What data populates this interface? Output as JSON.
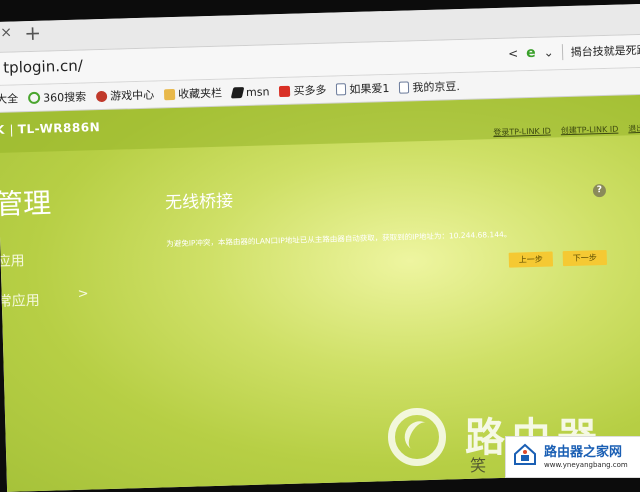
{
  "browser": {
    "tab_close_icon": "×",
    "new_tab_icon": "+",
    "url": "tplogin.cn/",
    "news_ticker": "揭台技就是死路一条",
    "bookmarks": [
      {
        "icon": "360-icon",
        "label": "大全"
      },
      {
        "icon": "360-search-icon",
        "label": "360搜索"
      },
      {
        "icon": "game-center-icon",
        "label": "游戏中心"
      },
      {
        "icon": "folder-icon",
        "label": "收藏夹栏"
      },
      {
        "icon": "msn-icon",
        "label": "msn"
      },
      {
        "icon": "jd-icon",
        "label": "买多多"
      },
      {
        "icon": "doc-icon",
        "label": "如果爱1"
      },
      {
        "icon": "doc-icon",
        "label": "我的京豆."
      }
    ]
  },
  "router": {
    "brand": "K",
    "model": "TL-WR886N",
    "top_links": {
      "login": "登录TP-LINK ID",
      "create": "创建TP-LINK ID",
      "exit": "退出"
    },
    "sidebar_title": "管理",
    "side_items": [
      "应用",
      "常应用"
    ],
    "side_arrow": ">",
    "panel_title": "无线桥接",
    "help_icon": "?",
    "message": "为避免IP冲突，本路由器的LAN口IP地址已从主路由器自动获取，获取到的IP地址为：10.244.68.144。",
    "buttons": {
      "prev": "上一步",
      "next": "下一步"
    }
  },
  "watermark": {
    "text": "路由器",
    "small": "笑",
    "badge_name": "路由器之家网",
    "badge_url": "www.yneyangbang.com"
  }
}
